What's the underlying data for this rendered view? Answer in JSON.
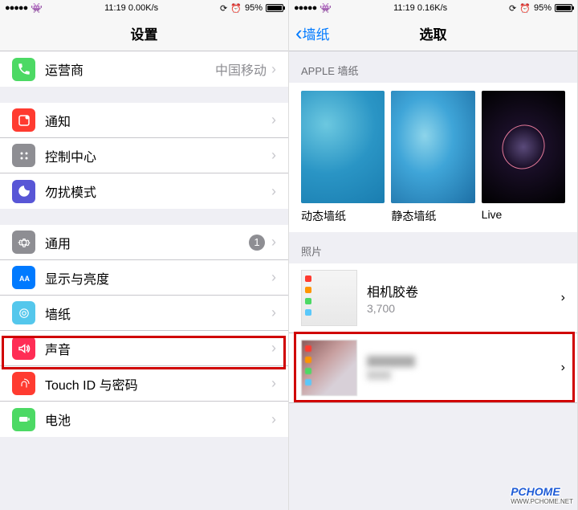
{
  "left": {
    "status": {
      "time": "11:19",
      "speed": "0.00K/s",
      "battery": "95%"
    },
    "title": "设置",
    "carrier": {
      "label": "运营商",
      "value": "中国移动"
    },
    "rows": {
      "notif": "通知",
      "ctrl": "控制中心",
      "dnd": "勿扰模式",
      "general": "通用",
      "general_badge": "1",
      "display": "显示与亮度",
      "wallpaper": "墙纸",
      "sound": "声音",
      "touchid": "Touch ID 与密码",
      "battery": "电池"
    }
  },
  "right": {
    "status": {
      "time": "11:19",
      "speed": "0.16K/s",
      "battery": "95%"
    },
    "back": "墙纸",
    "title": "选取",
    "section_apple": "APPLE 墙纸",
    "wp": {
      "dynamic": "动态墙纸",
      "static": "静态墙纸",
      "live": "Live"
    },
    "section_photos": "照片",
    "camera_roll": {
      "title": "相机胶卷",
      "count": "3,700"
    }
  },
  "watermark": {
    "main": "PCHOME",
    "sub": "WWW.PCHOME.NET"
  }
}
